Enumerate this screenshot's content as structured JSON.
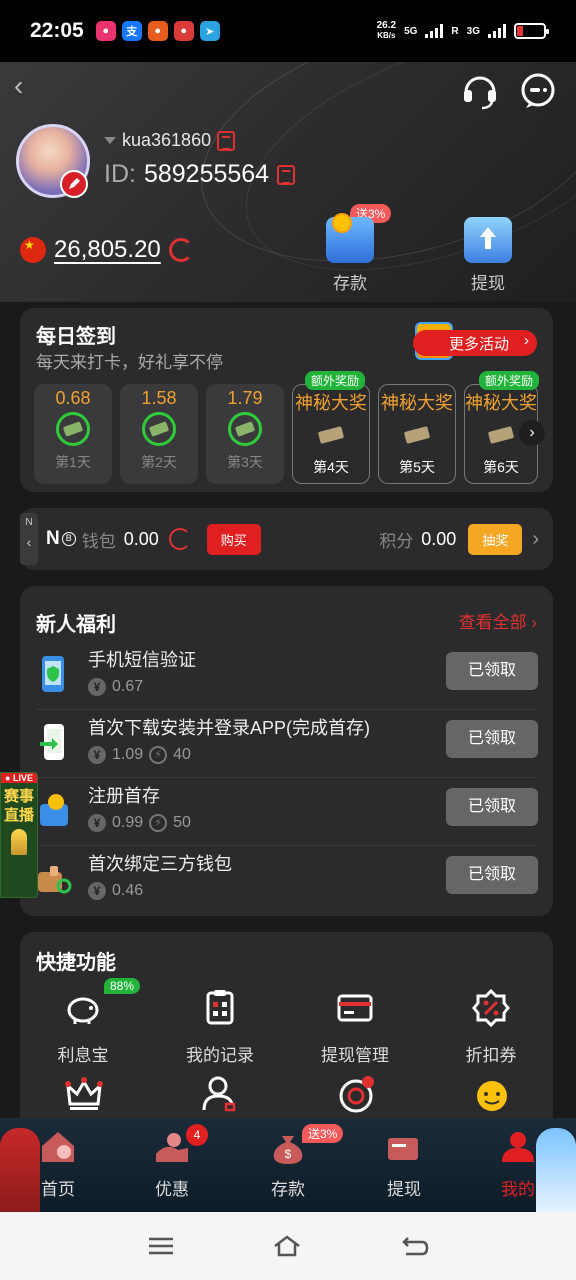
{
  "status_bar": {
    "time": "22:05",
    "network_speed": "26.2",
    "speed_unit": "KB/s",
    "sim1": "5G",
    "sim2": "3G",
    "sim2_extra": "R"
  },
  "header": {
    "username": "kua361860",
    "id_label": "ID:",
    "id_value": "589255564",
    "balance": "26,805.20",
    "deposit_label": "存款",
    "deposit_tag": "送3%",
    "withdraw_label": "提现"
  },
  "signin": {
    "title": "每日签到",
    "subtitle": "每天来打卡，好礼享不停",
    "more_label": "更多活动",
    "days": [
      {
        "value": "0.68",
        "label": "第1天"
      },
      {
        "value": "1.58",
        "label": "第2天"
      },
      {
        "value": "1.79",
        "label": "第3天"
      }
    ],
    "mystery_days": [
      {
        "title": "神秘大奖",
        "label": "第4天",
        "bonus": "额外奖励"
      },
      {
        "title": "神秘大奖",
        "label": "第5天",
        "bonus": ""
      },
      {
        "title": "神秘大奖",
        "label": "第6天",
        "bonus": "额外奖励"
      }
    ]
  },
  "wallet": {
    "tab_text": "N",
    "logo": "N",
    "coin": "B",
    "wallet_label": "钱包",
    "wallet_value": "0.00",
    "buy_label": "购买",
    "points_label": "积分",
    "points_value": "0.00",
    "draw_label": "抽奖"
  },
  "newbie": {
    "title": "新人福利",
    "view_all": "查看全部",
    "tasks": [
      {
        "name": "手机短信验证",
        "reward": "0.67",
        "bolt": "",
        "button": "已领取"
      },
      {
        "name": "首次下载安装并登录APP(完成首存)",
        "reward": "1.09",
        "bolt": "40",
        "button": "已领取"
      },
      {
        "name": "注册首存",
        "reward": "0.99",
        "bolt": "50",
        "button": "已领取"
      },
      {
        "name": "首次绑定三方钱包",
        "reward": "0.46",
        "bolt": "",
        "button": "已领取"
      }
    ]
  },
  "live_badge": {
    "live": "LIVE",
    "text1": "赛事",
    "text2": "直播"
  },
  "quick": {
    "title": "快捷功能",
    "pct_tag": "88%",
    "items": [
      {
        "label": "利息宝"
      },
      {
        "label": "我的记录"
      },
      {
        "label": "提现管理"
      },
      {
        "label": "折扣券"
      }
    ]
  },
  "bottom_nav": {
    "items": [
      {
        "label": "首页"
      },
      {
        "label": "优惠"
      },
      {
        "label": "存款"
      },
      {
        "label": "提现"
      },
      {
        "label": "我的"
      }
    ],
    "promo_badge": "4",
    "deposit_tag": "送3%"
  },
  "colors": {
    "accent_red": "#e02020",
    "reward_green": "#2fcc3a",
    "reward_orange": "#f0a030"
  }
}
